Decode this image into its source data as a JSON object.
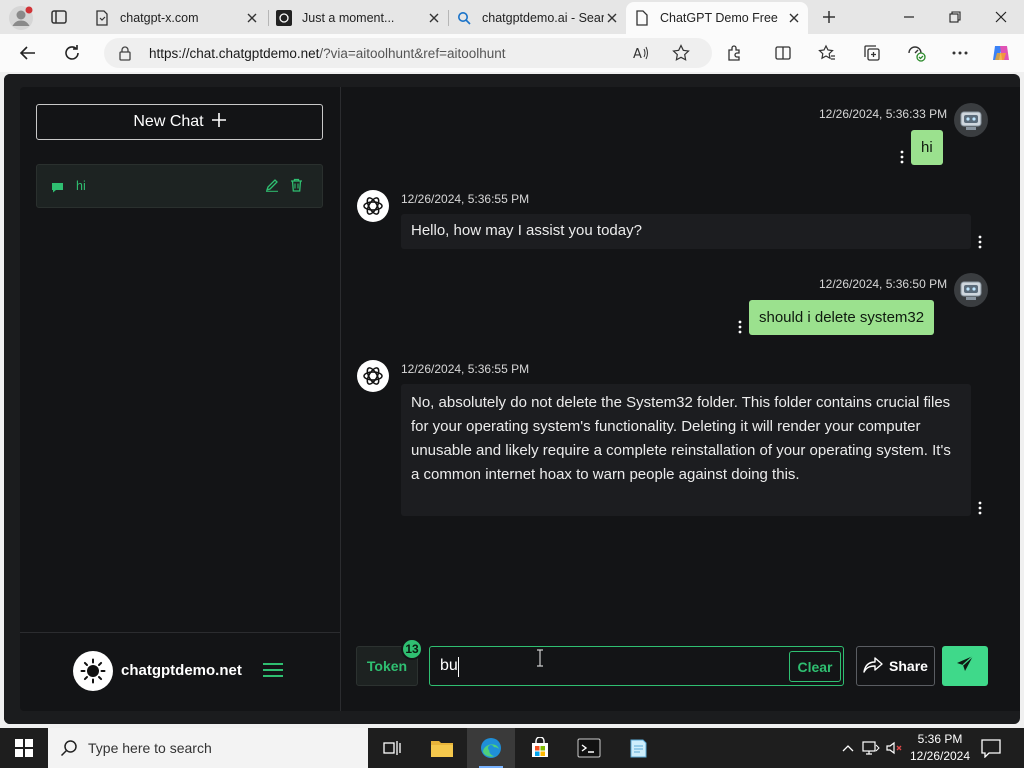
{
  "browser": {
    "tabs": [
      {
        "title": "chatgpt-x.com",
        "icon": "page-icon"
      },
      {
        "title": "Just a moment...",
        "icon": "chatgpt-logo-icon"
      },
      {
        "title": "chatgptdemo.ai - Sear",
        "icon": "search-icon"
      },
      {
        "title": "ChatGPT Demo Free",
        "icon": "page-icon",
        "active": true
      }
    ],
    "url_host": "https://chat.chatgptdemo.net",
    "url_path": "/?via=aitoolhunt&ref=aitoolhunt"
  },
  "sidebar": {
    "new_chat_label": "New Chat",
    "chats": [
      {
        "label": "hi"
      }
    ],
    "brand_name": "chatgptdemo.net"
  },
  "messages": [
    {
      "role": "user",
      "timestamp": "12/26/2024, 5:36:33 PM",
      "text": "hi"
    },
    {
      "role": "assistant",
      "timestamp": "12/26/2024, 5:36:55 PM",
      "text": "Hello, how may I assist you today?"
    },
    {
      "role": "user",
      "timestamp": "12/26/2024, 5:36:50 PM",
      "text": "should i delete system32"
    },
    {
      "role": "assistant",
      "timestamp": "12/26/2024, 5:36:55 PM",
      "text": "No, absolutely do not delete the System32 folder.  This folder contains crucial files for your operating system's functionality. Deleting it will render your computer unusable and likely require a complete reinstallation of your operating system.  It's a common internet hoax to warn people against doing this."
    }
  ],
  "composer": {
    "token_label": "Token",
    "token_count": "13",
    "input_value": "bu",
    "clear_label": "Clear",
    "share_label": "Share"
  },
  "taskbar": {
    "search_placeholder": "Type here to search",
    "time": "5:36 PM",
    "date": "12/26/2024"
  },
  "colors": {
    "accent": "#2fbf71",
    "user_bubble": "#9be18e",
    "send_button": "#3fd98a",
    "app_bg": "#131416"
  }
}
